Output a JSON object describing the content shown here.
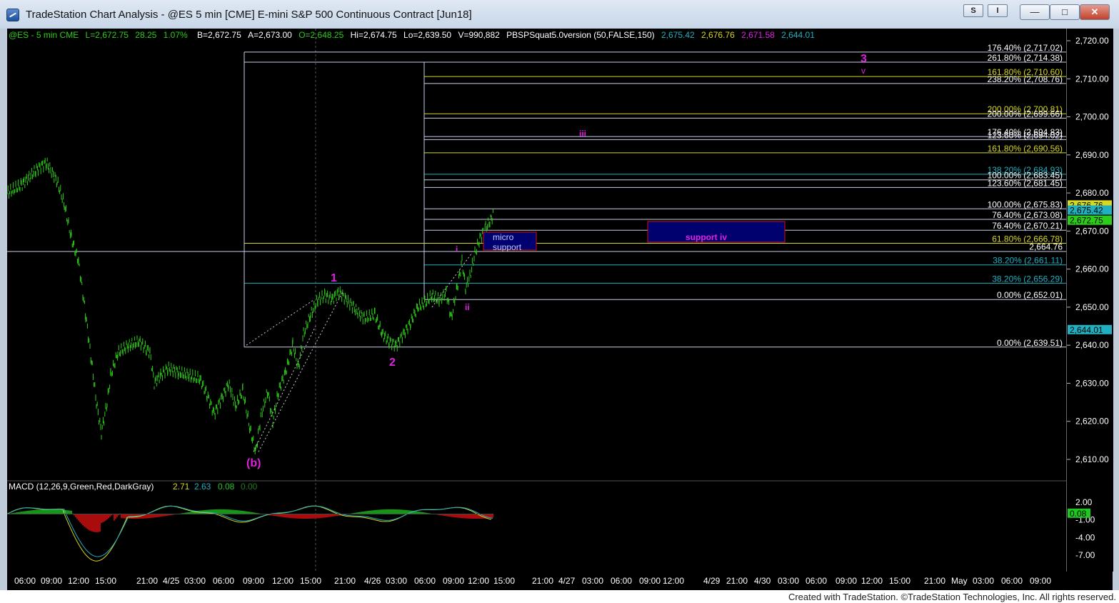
{
  "window": {
    "title": "TradeStation Chart Analysis - @ES 5 min [CME] E-mini S&P 500 Continuous Contract [Jun18]",
    "s_button": "S",
    "i_button": "I",
    "minimize": "—",
    "maximize": "□",
    "close": "✕"
  },
  "colors": {
    "price": "#2ecc1a",
    "wave_label": "#e020e0",
    "fib_yellow": "#d8d820",
    "fib_cyan": "#20b0c0",
    "support_box": "#00006e",
    "support_border": "#d01010",
    "macd_green": "#1ec81e",
    "macd_red": "#e01010"
  },
  "header": {
    "symbol": "@ES - 5 min  CME",
    "last": "L=2,672.75",
    "change": "28.25",
    "pct": "1.07%",
    "bid": "B=2,672.75",
    "ask": "A=2,673.00",
    "open": "O=2,648.25",
    "hi": "Hi=2,674.75",
    "lo": "Lo=2,639.50",
    "vol": "V=990,882",
    "study": "PBSPSquat5.0version (50,FALSE,150)",
    "v1": "2,675.42",
    "v2": "2,676.76",
    "v3": "2,671.58",
    "v4": "2,644.01"
  },
  "y_ticks": [
    "2,720.00",
    "2,710.00",
    "2,700.00",
    "2,690.00",
    "2,680.00",
    "2,670.00",
    "2,660.00",
    "2,650.00",
    "2,640.00",
    "2,630.00",
    "2,620.00",
    "2,610.00"
  ],
  "y_tick_values": [
    2720,
    2710,
    2700,
    2690,
    2680,
    2670,
    2660,
    2650,
    2640,
    2630,
    2620,
    2610
  ],
  "price_badges": [
    {
      "text": "2,676.76",
      "value": 2676.76,
      "color": "#d8d820"
    },
    {
      "text": "2,675.42",
      "value": 2675.42,
      "color": "#20b0c0"
    },
    {
      "text": "2,672.75",
      "value": 2672.75,
      "color": "#2ecc1a"
    },
    {
      "text": "2,644.01",
      "value": 2644.01,
      "color": "#20b0c0"
    }
  ],
  "fib_levels": [
    {
      "text": "176.40% (2,717.02)",
      "value": 2717.02
    },
    {
      "text": "261.80% (2,714.38)",
      "value": 2714.38
    },
    {
      "text": "161.80% (2,710.60)",
      "value": 2710.6
    },
    {
      "text": "238.20% (2,708.76)",
      "value": 2708.76
    },
    {
      "text": "200.00% (2,700.81)",
      "value": 2700.81
    },
    {
      "text": "200.00% (2,699.66)",
      "value": 2699.66
    },
    {
      "text": "176.40% (2,694.83)",
      "value": 2694.83
    },
    {
      "text": "123.60% (2,694.02)",
      "value": 2694.02
    },
    {
      "text": "161.80% (2,690.56)",
      "value": 2690.56
    },
    {
      "text": "138.20% (2,684.93)",
      "value": 2684.93
    },
    {
      "text": "100.00% (2,683.45)",
      "value": 2683.45
    },
    {
      "text": "123.60% (2,681.45)",
      "value": 2681.45
    },
    {
      "text": "100.00% (2,675.83)",
      "value": 2675.83
    },
    {
      "text": "76.40% (2,673.08)",
      "value": 2673.08
    },
    {
      "text": "76.40% (2,670.21)",
      "value": 2670.21
    },
    {
      "text": "61.80% (2,666.78)",
      "value": 2666.78
    },
    {
      "text": "2,664.76",
      "value": 2664.76
    },
    {
      "text": "38.20% (2,661.11)",
      "value": 2661.11
    },
    {
      "text": "38.20% (2,656.29)",
      "value": 2656.29
    },
    {
      "text": "0.00% (2,652.01)",
      "value": 2652.01
    },
    {
      "text": "0.00% (2,639.51)",
      "value": 2639.51
    }
  ],
  "wave_labels": {
    "w3": "3",
    "wv": "v",
    "wiii": "iii",
    "wi": "i",
    "wii": "ii",
    "w1": "1",
    "w2": "2",
    "wb": "(b)"
  },
  "boxes": {
    "micro": "micro",
    "support": "support",
    "support_iv": "support iv"
  },
  "macd": {
    "label": "MACD (12,26,9,Green,Red,DarkGray)",
    "v1": "2.71",
    "v2": "2.63",
    "v3": "0.08",
    "v4": "0.00",
    "ticks": [
      "2.00",
      "-1.00",
      "-4.00",
      "-7.00"
    ],
    "tick_values": [
      2.0,
      -1.0,
      -4.0,
      -7.0
    ],
    "badge": "0.08"
  },
  "x_ticks": [
    "06:00",
    "09:00",
    "12:00",
    "15:00",
    "21:00",
    "4/25",
    "03:00",
    "06:00",
    "09:00",
    "12:00",
    "15:00",
    "21:00",
    "4/26",
    "03:00",
    "06:00",
    "09:00",
    "12:00",
    "15:00",
    "21:00",
    "4/27",
    "03:00",
    "06:00",
    "09:00",
    "12:00",
    "4/29",
    "21:00",
    "4/30",
    "03:00",
    "06:00",
    "09:00",
    "12:00",
    "15:00",
    "21:00",
    "May",
    "03:00",
    "06:00",
    "09:00"
  ],
  "footer": "Created with TradeStation. ©TradeStation Technologies, Inc. All rights reserved."
}
